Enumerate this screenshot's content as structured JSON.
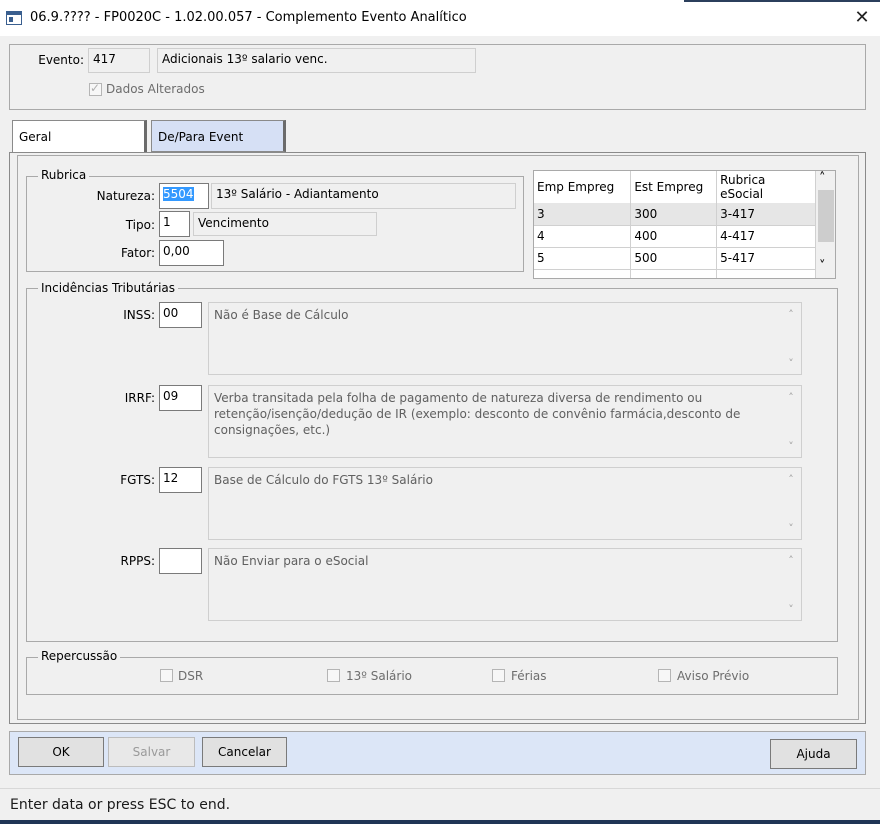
{
  "window": {
    "title": "06.9.???? - FP0020C - 1.02.00.057 - Complemento Evento Analítico",
    "close_glyph": "✕"
  },
  "evento": {
    "label": "Evento:",
    "code": "417",
    "description": "Adicionais 13º salario venc.",
    "dados_alterados_label": "Dados Alterados",
    "dados_alterados_checked": true
  },
  "tabs": [
    {
      "label": "Geral",
      "active": true
    },
    {
      "label": "De/Para Event",
      "active": false
    }
  ],
  "rubrica": {
    "caption": "Rubrica",
    "natureza_label": "Natureza:",
    "natureza_code": "5504",
    "natureza_desc": "13º Salário - Adiantamento",
    "tipo_label": "Tipo:",
    "tipo_code": "1",
    "tipo_desc": "Vencimento",
    "fator_label": "Fator:",
    "fator_value": "0,00"
  },
  "grid": {
    "columns": [
      "Emp Empreg",
      "Est Empreg",
      "Rubrica eSocial"
    ],
    "rows": [
      [
        "3",
        "300",
        "3-417"
      ],
      [
        "4",
        "400",
        "4-417"
      ],
      [
        "5",
        "500",
        "5-417"
      ],
      [
        "",
        "",
        ""
      ]
    ]
  },
  "incidencias": {
    "caption": "Incidências Tributárias",
    "items": [
      {
        "label": "INSS:",
        "code": "00",
        "desc": "Não é Base de Cálculo"
      },
      {
        "label": "IRRF:",
        "code": "09",
        "desc": "Verba transitada pela folha de pagamento de natureza diversa de rendimento ou retenção/isenção/dedução de IR (exemplo: desconto de convênio farmácia,desconto de consignações, etc.)"
      },
      {
        "label": "FGTS:",
        "code": "12",
        "desc": "Base de Cálculo do FGTS 13º Salário"
      },
      {
        "label": "RPPS:",
        "code": "",
        "desc": "Não Enviar para o eSocial"
      }
    ]
  },
  "repercussao": {
    "caption": "Repercussão",
    "options": [
      "DSR",
      "13º Salário",
      "Férias",
      "Aviso Prévio"
    ]
  },
  "buttons": {
    "ok": "OK",
    "salvar": "Salvar",
    "cancelar": "Cancelar",
    "ajuda": "Ajuda"
  },
  "status": "Enter data or press ESC to end.",
  "icons": {
    "scroll_up": "˄",
    "scroll_down": "˅",
    "check": "✓"
  }
}
